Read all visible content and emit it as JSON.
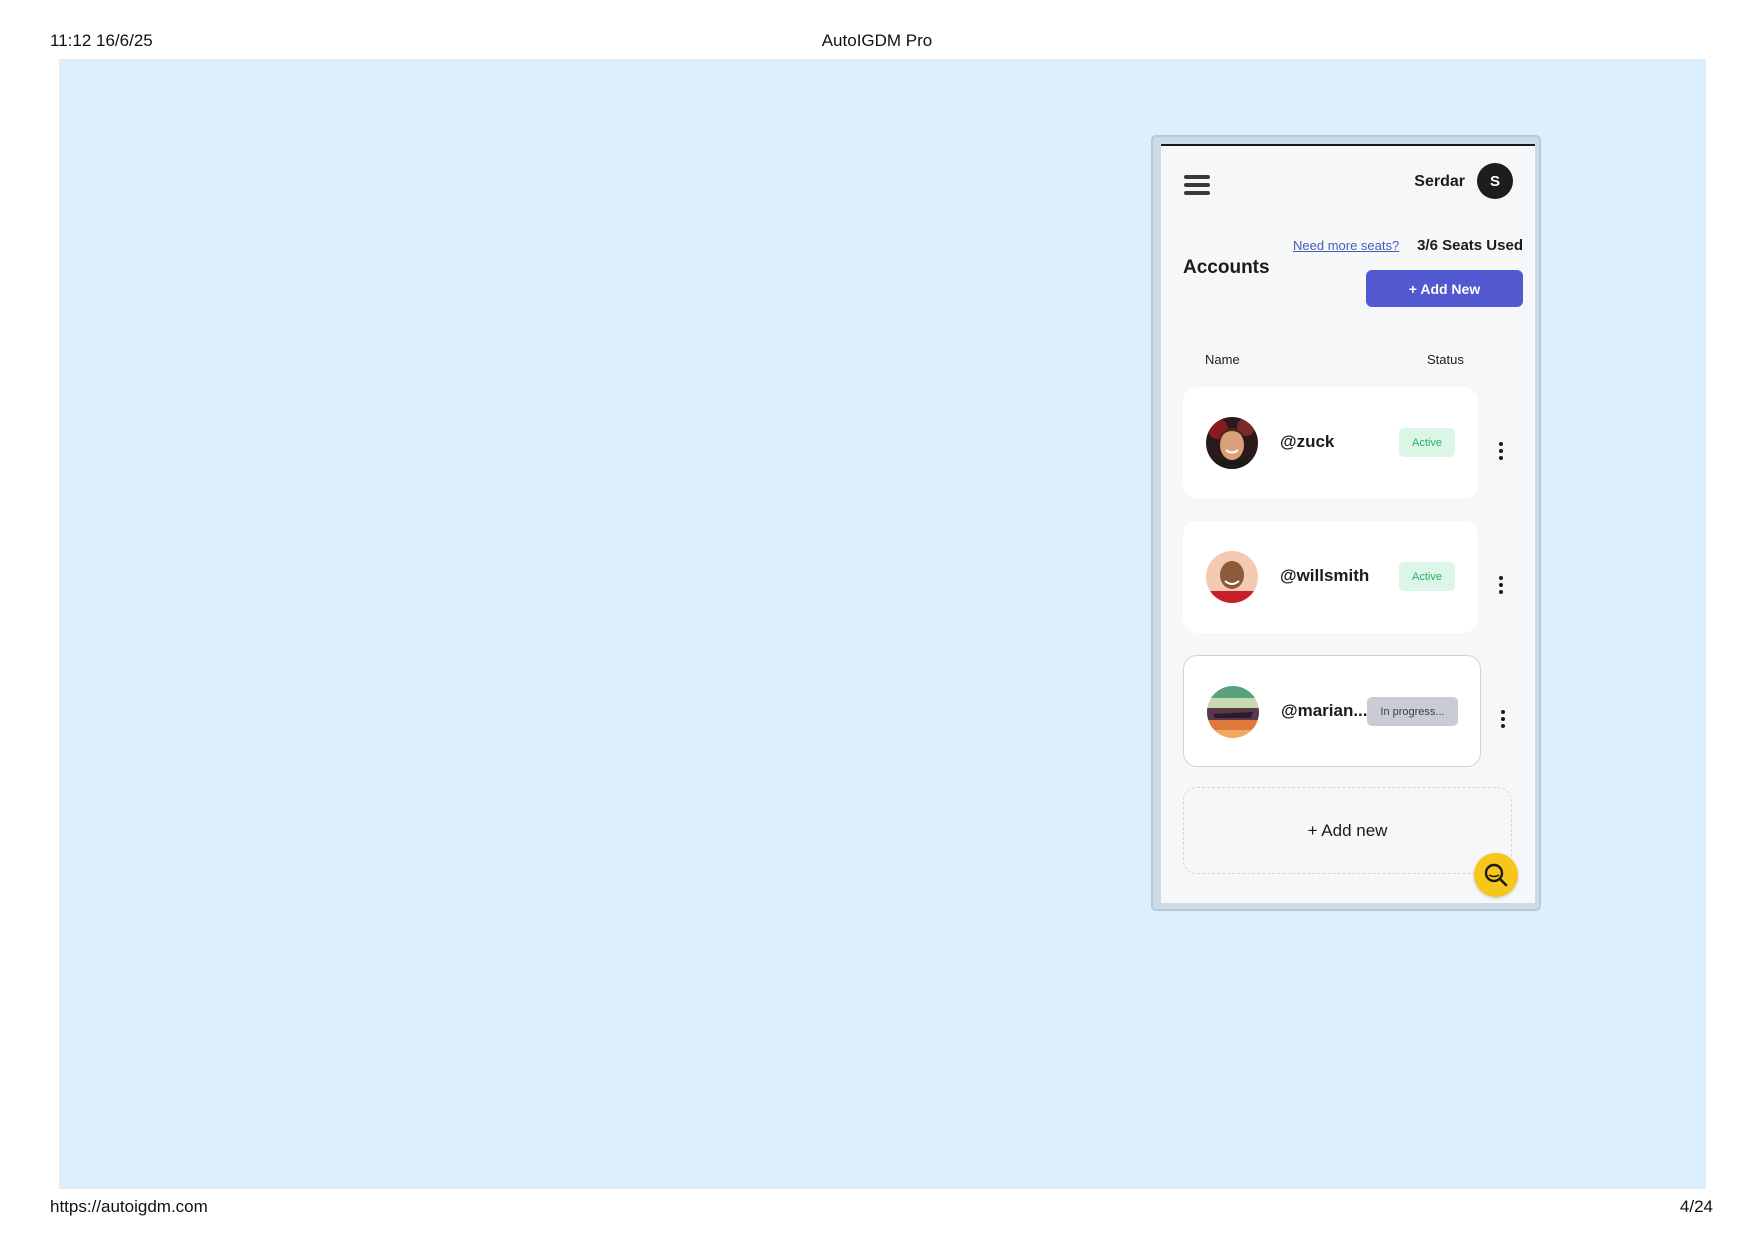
{
  "print": {
    "datetime": "11:12 16/6/25",
    "title": "AutoIGDM Pro",
    "url": "https://autoigdm.com",
    "page": "4/24"
  },
  "header": {
    "user_name": "Serdar",
    "user_initial": "S"
  },
  "seats": {
    "link_label": "Need more seats?",
    "used_label": "3/6 Seats Used"
  },
  "accounts": {
    "title": "Accounts",
    "add_button_label": "+ Add New",
    "columns": {
      "name": "Name",
      "status": "Status"
    },
    "items": [
      {
        "handle": "@zuck",
        "status": "Active"
      },
      {
        "handle": "@willsmith",
        "status": "Active"
      },
      {
        "handle": "@marian...",
        "status": "In progress..."
      }
    ],
    "add_new_label": "+ Add new"
  },
  "colors": {
    "canvas_bg": "#ddeffd",
    "accent": "#5258cf",
    "active_bg": "#dbf6e6",
    "active_text": "#2ab06a",
    "progress_bg": "#c9ccd2",
    "fab": "#f7c61a"
  },
  "icons": {
    "menu": "hamburger-menu-icon",
    "more": "kebab-vertical-icon",
    "search": "search-icon"
  }
}
